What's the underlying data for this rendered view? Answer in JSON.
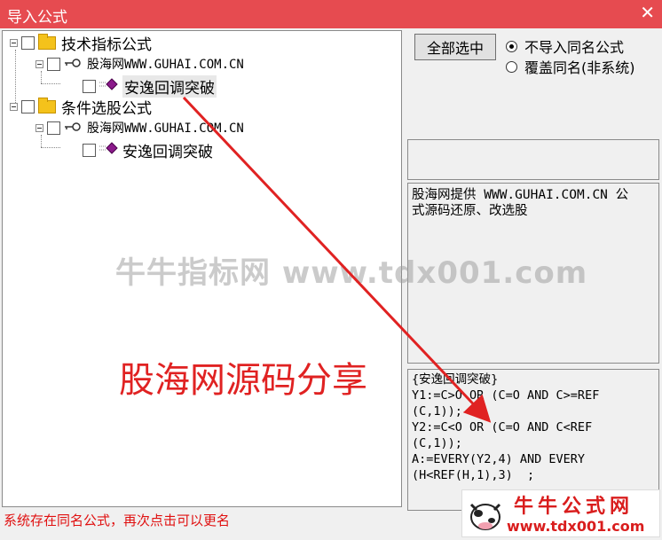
{
  "window": {
    "title": "导入公式",
    "close_glyph": "✕"
  },
  "tree": {
    "groups": [
      {
        "label": "技术指标公式",
        "source": "股海网WWW.GUHAI.COM.CN",
        "formula": "安逸回调突破"
      },
      {
        "label": "条件选股公式",
        "source": "股海网WWW.GUHAI.COM.CN",
        "formula": "安逸回调突破"
      }
    ]
  },
  "controls": {
    "select_all_label": "全部选中",
    "radio_options": [
      {
        "label": "不导入同名公式",
        "selected": true
      },
      {
        "label": "覆盖同名(非系统)",
        "selected": false
      }
    ]
  },
  "description": {
    "lines": [
      "股海网提供 WWW.GUHAI.COM.CN 公",
      "式源码还原、改选股"
    ]
  },
  "code": {
    "lines": [
      "{安逸回调突破}",
      "Y1:=C>O OR (C=O AND C>=REF",
      "(C,1));",
      "Y2:=C<O OR (C=O AND C<REF",
      "(C,1));",
      "A:=EVERY(Y2,4) AND EVERY",
      "(H<REF(H,1),3)  ;"
    ]
  },
  "status_message": "系统存在同名公式，再次点击可以更名",
  "watermarks": {
    "center_text": "牛牛指标网 www.tdx001.com",
    "red_text": "股海网源码分享",
    "logo_title": "牛牛公式网",
    "logo_url": "www.tdx001.com"
  },
  "colors": {
    "titlebar": "#e64b50",
    "status_text": "#e01010",
    "annotation_red": "#e02222",
    "formula_icon": "#8b1a8b"
  },
  "icons": {
    "expander": "minus-box-icon",
    "folder": "folder-icon",
    "key": "key-icon",
    "formula": "diamond-formula-icon"
  }
}
